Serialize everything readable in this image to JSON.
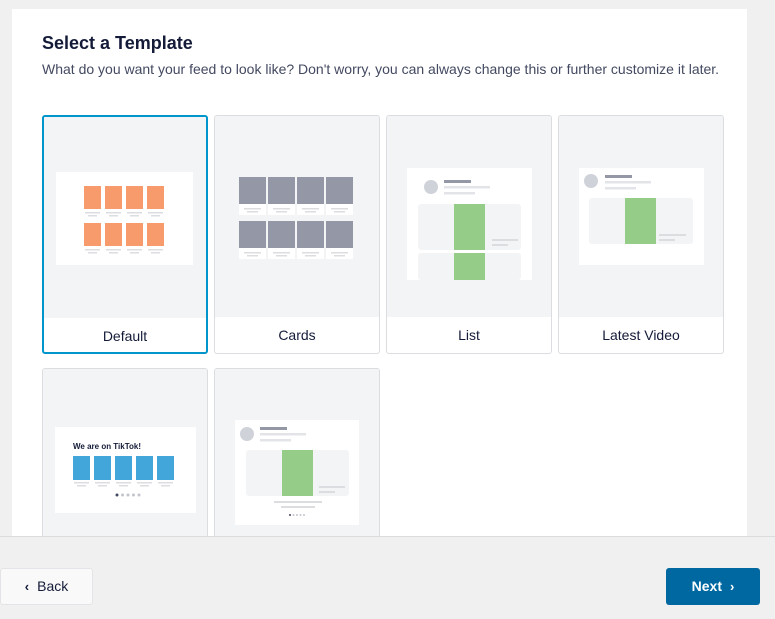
{
  "header": {
    "title": "Select a Template",
    "subtitle": "What do you want your feed to look like? Don't worry, you can always change this or further customize it later."
  },
  "templates": [
    {
      "label": "Default",
      "selected": true
    },
    {
      "label": "Cards",
      "selected": false
    },
    {
      "label": "List",
      "selected": false
    },
    {
      "label": "Latest Video",
      "selected": false
    },
    {
      "label": "",
      "preview_heading": "We are on TikTok!",
      "selected": false
    },
    {
      "label": "",
      "selected": false
    }
  ],
  "footer": {
    "back_label": "Back",
    "next_label": "Next",
    "back_icon": "chevron-left-icon",
    "next_icon": "chevron-right-icon"
  },
  "colors": {
    "accent": "#0096cc",
    "next_button": "#0068a0",
    "default_tile": "#f79b6d",
    "video_tile": "#94cc88",
    "tiktok_tile": "#43a6db"
  }
}
